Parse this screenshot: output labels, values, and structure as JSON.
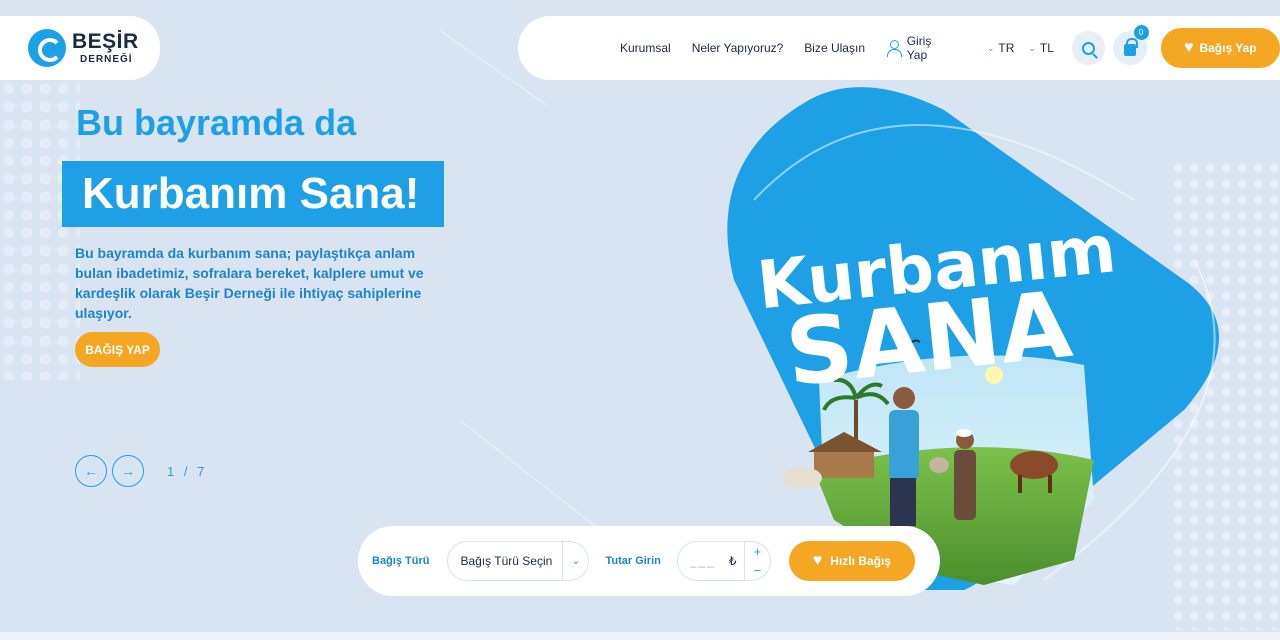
{
  "brand": {
    "name": "BEŞİR",
    "sub": "DERNEĞİ",
    "color": "#1ea0e6"
  },
  "nav": {
    "links": [
      "Kurumsal",
      "Neler Yapıyoruz?",
      "Bize Ulaşın"
    ],
    "login_label": "Giriş Yap",
    "language": "TR",
    "currency": "TL",
    "cart_count": "0",
    "donate_label": "Bağış Yap"
  },
  "hero": {
    "pretitle": "Bu bayramda da",
    "title": "Kurbanım Sana!",
    "description": "Bu bayramda da kurbanım sana; paylaştıkça anlam bulan ibadetimiz, sofralara bereket, kalplere umut ve kardeşlik olarak Beşir Derneği ile ihtiyaç sahiplerine ulaşıyor.",
    "cta_label": "BAĞIŞ YAP",
    "slide_counter": "1 / 7",
    "prev_arrow": "←",
    "next_arrow": "→"
  },
  "banner": {
    "line1": "Kurbanım",
    "line2": "SANA"
  },
  "quick_donate": {
    "type_label": "Bağış Türü",
    "type_select_value": "Bağış Türü Seçin",
    "amount_label": "Tutar Girin",
    "amount_placeholder": "___",
    "currency_symbol": "₺",
    "plus": "+",
    "minus": "−",
    "button_label": "Hızlı Bağış"
  },
  "colors": {
    "accent": "#1ea0e6",
    "orange": "#f5a623",
    "background": "#d9e4f2"
  }
}
